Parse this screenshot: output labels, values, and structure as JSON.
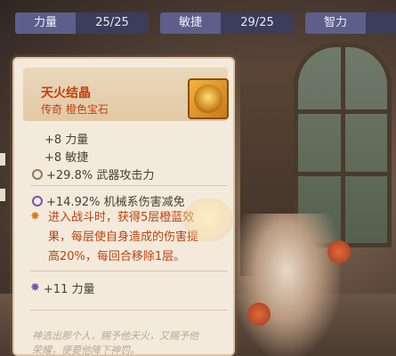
{
  "stats": [
    {
      "label": "力量",
      "value": "25/25"
    },
    {
      "label": "敏捷",
      "value": "29/25"
    },
    {
      "label": "智力",
      "value": ""
    }
  ],
  "item": {
    "name": "天火结晶",
    "subtitle": "传奇 橙色宝石",
    "icon": "gem-icon"
  },
  "base_stats": [
    "+8 力量",
    "+8 敏捷"
  ],
  "affix_main": "+29.8% 武器攻击力",
  "affix_2": "+14.92% 机械系伤害减免",
  "special_text": "进入战斗时，获得5层橙蓝效果，每层使自身造成的伤害提高20%，每回合移除1层。",
  "special_lines": [
    "进入战斗时，获得5层橙蓝效",
    "果，每层使自身造成的伤害提",
    "高20%，每回合移除1层。"
  ],
  "bonus": "+11 力量",
  "flavor_lines": [
    "神选出那个人，赐予他天火，又赐予他",
    "荣耀，便要他降下神罚。"
  ],
  "colors": {
    "legendary": "#c2410c",
    "stat_label_bg": "#5b5f8a",
    "stat_value_bg": "#3b3d5a",
    "card_bg": "#f3eadc"
  }
}
